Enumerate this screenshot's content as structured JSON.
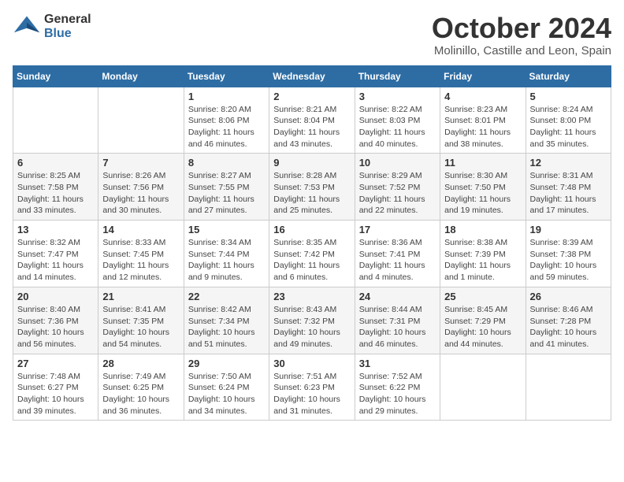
{
  "logo": {
    "line1": "General",
    "line2": "Blue"
  },
  "title": "October 2024",
  "subtitle": "Molinillo, Castille and Leon, Spain",
  "weekdays": [
    "Sunday",
    "Monday",
    "Tuesday",
    "Wednesday",
    "Thursday",
    "Friday",
    "Saturday"
  ],
  "weeks": [
    [
      {
        "day": "",
        "info": ""
      },
      {
        "day": "",
        "info": ""
      },
      {
        "day": "1",
        "info": "Sunrise: 8:20 AM\nSunset: 8:06 PM\nDaylight: 11 hours and 46 minutes."
      },
      {
        "day": "2",
        "info": "Sunrise: 8:21 AM\nSunset: 8:04 PM\nDaylight: 11 hours and 43 minutes."
      },
      {
        "day": "3",
        "info": "Sunrise: 8:22 AM\nSunset: 8:03 PM\nDaylight: 11 hours and 40 minutes."
      },
      {
        "day": "4",
        "info": "Sunrise: 8:23 AM\nSunset: 8:01 PM\nDaylight: 11 hours and 38 minutes."
      },
      {
        "day": "5",
        "info": "Sunrise: 8:24 AM\nSunset: 8:00 PM\nDaylight: 11 hours and 35 minutes."
      }
    ],
    [
      {
        "day": "6",
        "info": "Sunrise: 8:25 AM\nSunset: 7:58 PM\nDaylight: 11 hours and 33 minutes."
      },
      {
        "day": "7",
        "info": "Sunrise: 8:26 AM\nSunset: 7:56 PM\nDaylight: 11 hours and 30 minutes."
      },
      {
        "day": "8",
        "info": "Sunrise: 8:27 AM\nSunset: 7:55 PM\nDaylight: 11 hours and 27 minutes."
      },
      {
        "day": "9",
        "info": "Sunrise: 8:28 AM\nSunset: 7:53 PM\nDaylight: 11 hours and 25 minutes."
      },
      {
        "day": "10",
        "info": "Sunrise: 8:29 AM\nSunset: 7:52 PM\nDaylight: 11 hours and 22 minutes."
      },
      {
        "day": "11",
        "info": "Sunrise: 8:30 AM\nSunset: 7:50 PM\nDaylight: 11 hours and 19 minutes."
      },
      {
        "day": "12",
        "info": "Sunrise: 8:31 AM\nSunset: 7:48 PM\nDaylight: 11 hours and 17 minutes."
      }
    ],
    [
      {
        "day": "13",
        "info": "Sunrise: 8:32 AM\nSunset: 7:47 PM\nDaylight: 11 hours and 14 minutes."
      },
      {
        "day": "14",
        "info": "Sunrise: 8:33 AM\nSunset: 7:45 PM\nDaylight: 11 hours and 12 minutes."
      },
      {
        "day": "15",
        "info": "Sunrise: 8:34 AM\nSunset: 7:44 PM\nDaylight: 11 hours and 9 minutes."
      },
      {
        "day": "16",
        "info": "Sunrise: 8:35 AM\nSunset: 7:42 PM\nDaylight: 11 hours and 6 minutes."
      },
      {
        "day": "17",
        "info": "Sunrise: 8:36 AM\nSunset: 7:41 PM\nDaylight: 11 hours and 4 minutes."
      },
      {
        "day": "18",
        "info": "Sunrise: 8:38 AM\nSunset: 7:39 PM\nDaylight: 11 hours and 1 minute."
      },
      {
        "day": "19",
        "info": "Sunrise: 8:39 AM\nSunset: 7:38 PM\nDaylight: 10 hours and 59 minutes."
      }
    ],
    [
      {
        "day": "20",
        "info": "Sunrise: 8:40 AM\nSunset: 7:36 PM\nDaylight: 10 hours and 56 minutes."
      },
      {
        "day": "21",
        "info": "Sunrise: 8:41 AM\nSunset: 7:35 PM\nDaylight: 10 hours and 54 minutes."
      },
      {
        "day": "22",
        "info": "Sunrise: 8:42 AM\nSunset: 7:34 PM\nDaylight: 10 hours and 51 minutes."
      },
      {
        "day": "23",
        "info": "Sunrise: 8:43 AM\nSunset: 7:32 PM\nDaylight: 10 hours and 49 minutes."
      },
      {
        "day": "24",
        "info": "Sunrise: 8:44 AM\nSunset: 7:31 PM\nDaylight: 10 hours and 46 minutes."
      },
      {
        "day": "25",
        "info": "Sunrise: 8:45 AM\nSunset: 7:29 PM\nDaylight: 10 hours and 44 minutes."
      },
      {
        "day": "26",
        "info": "Sunrise: 8:46 AM\nSunset: 7:28 PM\nDaylight: 10 hours and 41 minutes."
      }
    ],
    [
      {
        "day": "27",
        "info": "Sunrise: 7:48 AM\nSunset: 6:27 PM\nDaylight: 10 hours and 39 minutes."
      },
      {
        "day": "28",
        "info": "Sunrise: 7:49 AM\nSunset: 6:25 PM\nDaylight: 10 hours and 36 minutes."
      },
      {
        "day": "29",
        "info": "Sunrise: 7:50 AM\nSunset: 6:24 PM\nDaylight: 10 hours and 34 minutes."
      },
      {
        "day": "30",
        "info": "Sunrise: 7:51 AM\nSunset: 6:23 PM\nDaylight: 10 hours and 31 minutes."
      },
      {
        "day": "31",
        "info": "Sunrise: 7:52 AM\nSunset: 6:22 PM\nDaylight: 10 hours and 29 minutes."
      },
      {
        "day": "",
        "info": ""
      },
      {
        "day": "",
        "info": ""
      }
    ]
  ]
}
